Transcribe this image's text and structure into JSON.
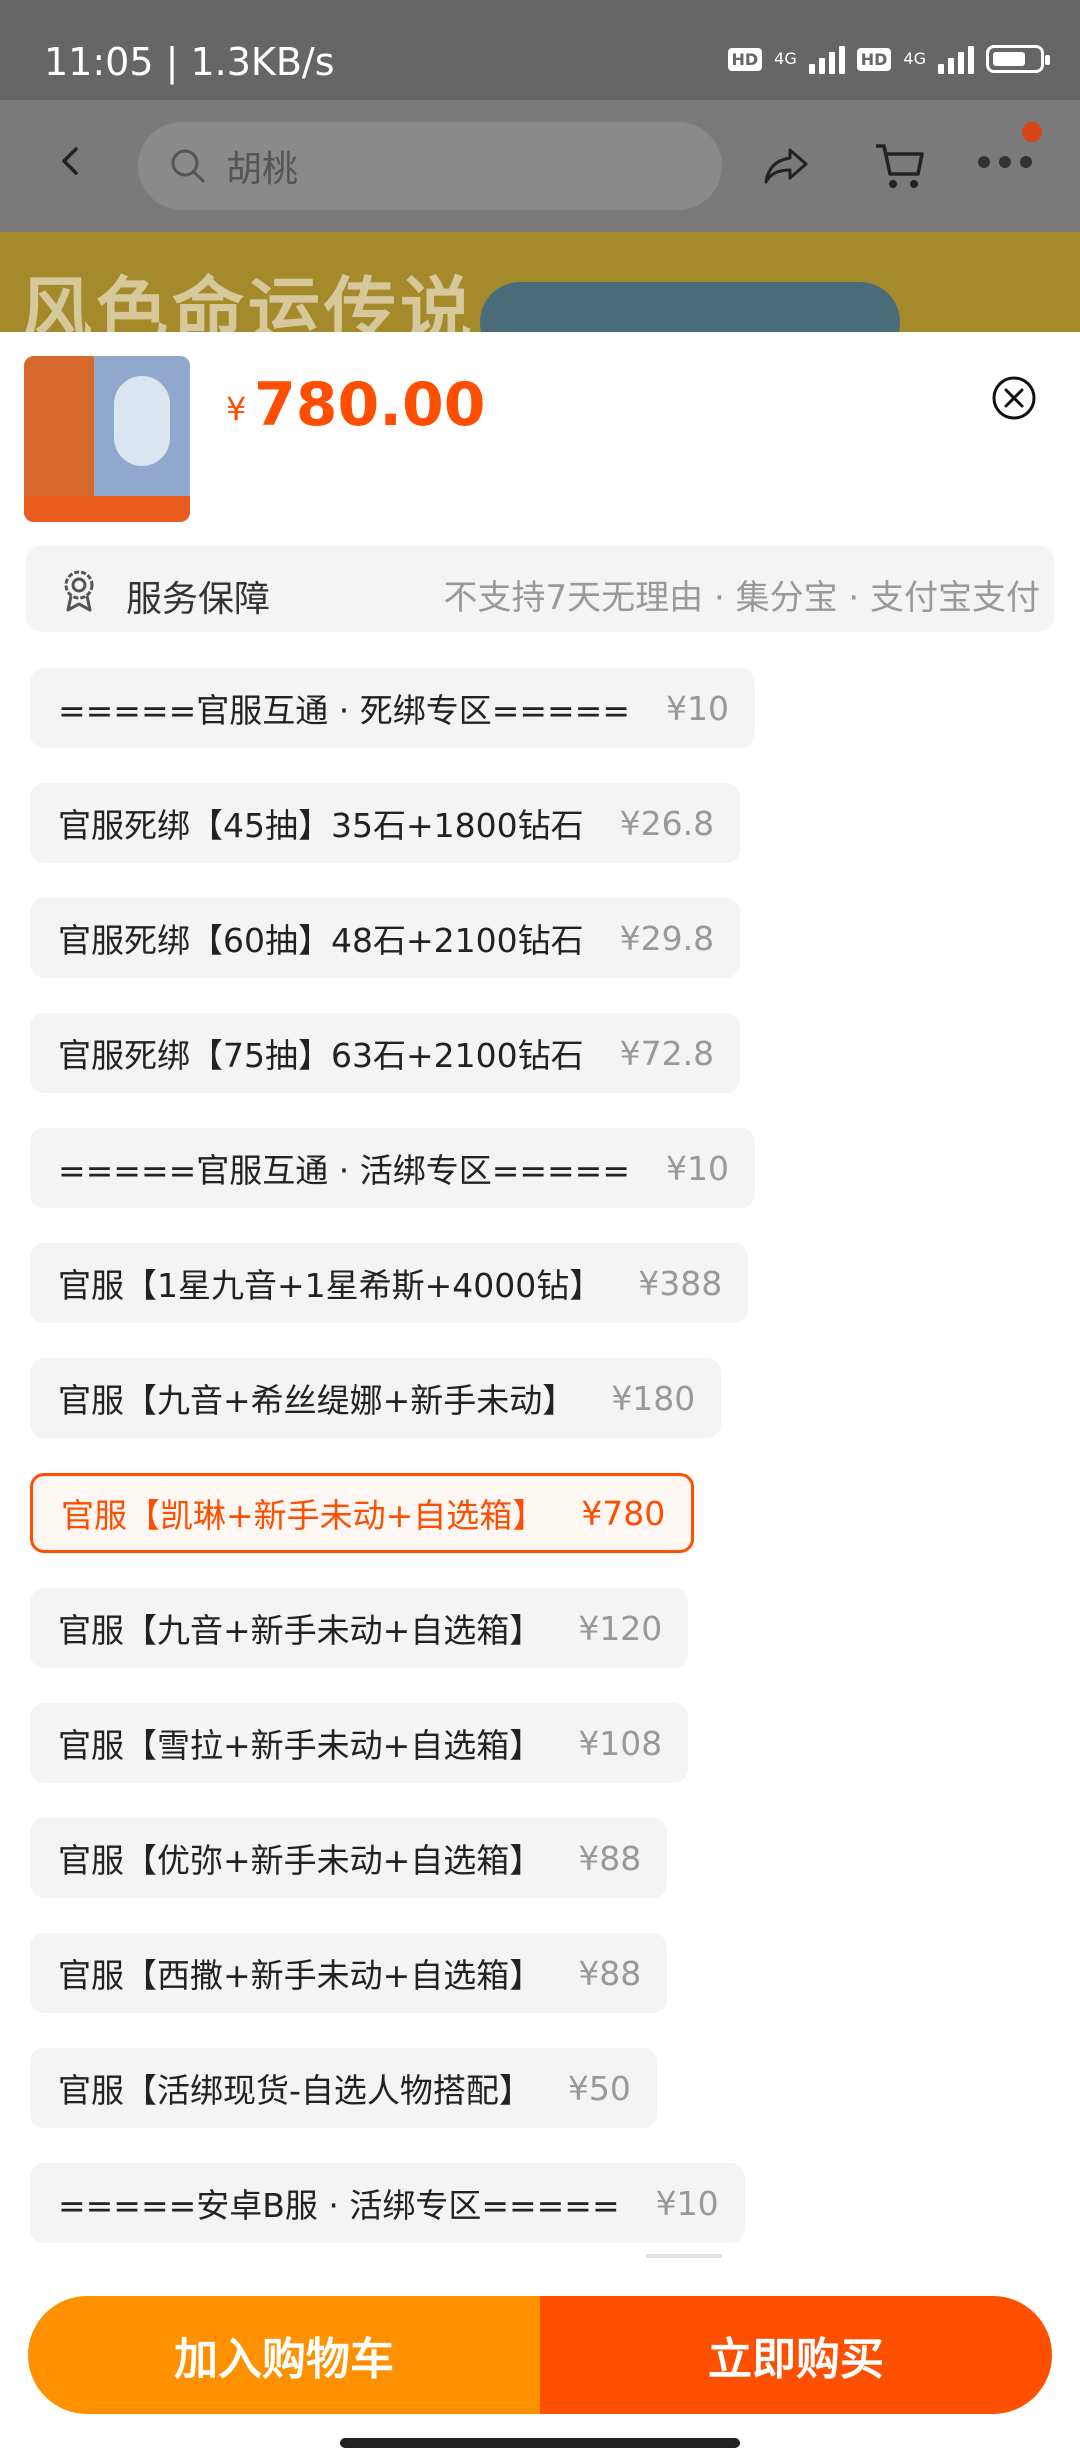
{
  "status_bar": {
    "time_speed": "11:05 | 1.3KB/s",
    "hd_badge": "HD",
    "network": "4G"
  },
  "header": {
    "search_placeholder": "胡桃"
  },
  "banner": {
    "text": "风色命运传说"
  },
  "product": {
    "currency": "¥",
    "price": "780.00"
  },
  "service": {
    "title": "服务保障",
    "description": "不支持7天无理由 · 集分宝 · 支付宝支付"
  },
  "options": [
    {
      "label": "=====官服互通 · 死绑专区=====",
      "price": "¥10",
      "selected": false
    },
    {
      "label": "官服死绑【45抽】35石+1800钻石",
      "price": "¥26.8",
      "selected": false
    },
    {
      "label": "官服死绑【60抽】48石+2100钻石",
      "price": "¥29.8",
      "selected": false
    },
    {
      "label": "官服死绑【75抽】63石+2100钻石",
      "price": "¥72.8",
      "selected": false
    },
    {
      "label": "=====官服互通 · 活绑专区=====",
      "price": "¥10",
      "selected": false
    },
    {
      "label": "官服【1星九音+1星希斯+4000钻】",
      "price": "¥388",
      "selected": false
    },
    {
      "label": "官服【九音+希丝缇娜+新手未动】",
      "price": "¥180",
      "selected": false
    },
    {
      "label": "官服【凯琳+新手未动+自选箱】",
      "price": "¥780",
      "selected": true
    },
    {
      "label": "官服【九音+新手未动+自选箱】",
      "price": "¥120",
      "selected": false
    },
    {
      "label": "官服【雪拉+新手未动+自选箱】",
      "price": "¥108",
      "selected": false
    },
    {
      "label": "官服【优弥+新手未动+自选箱】",
      "price": "¥88",
      "selected": false
    },
    {
      "label": "官服【西撒+新手未动+自选箱】",
      "price": "¥88",
      "selected": false
    },
    {
      "label": "官服【活绑现货-自选人物搭配】",
      "price": "¥50",
      "selected": false
    },
    {
      "label": "=====安卓B服 · 活绑专区=====",
      "price": "¥10",
      "selected": false
    }
  ],
  "actions": {
    "add_to_cart": "加入购物车",
    "buy_now": "立即购买"
  }
}
